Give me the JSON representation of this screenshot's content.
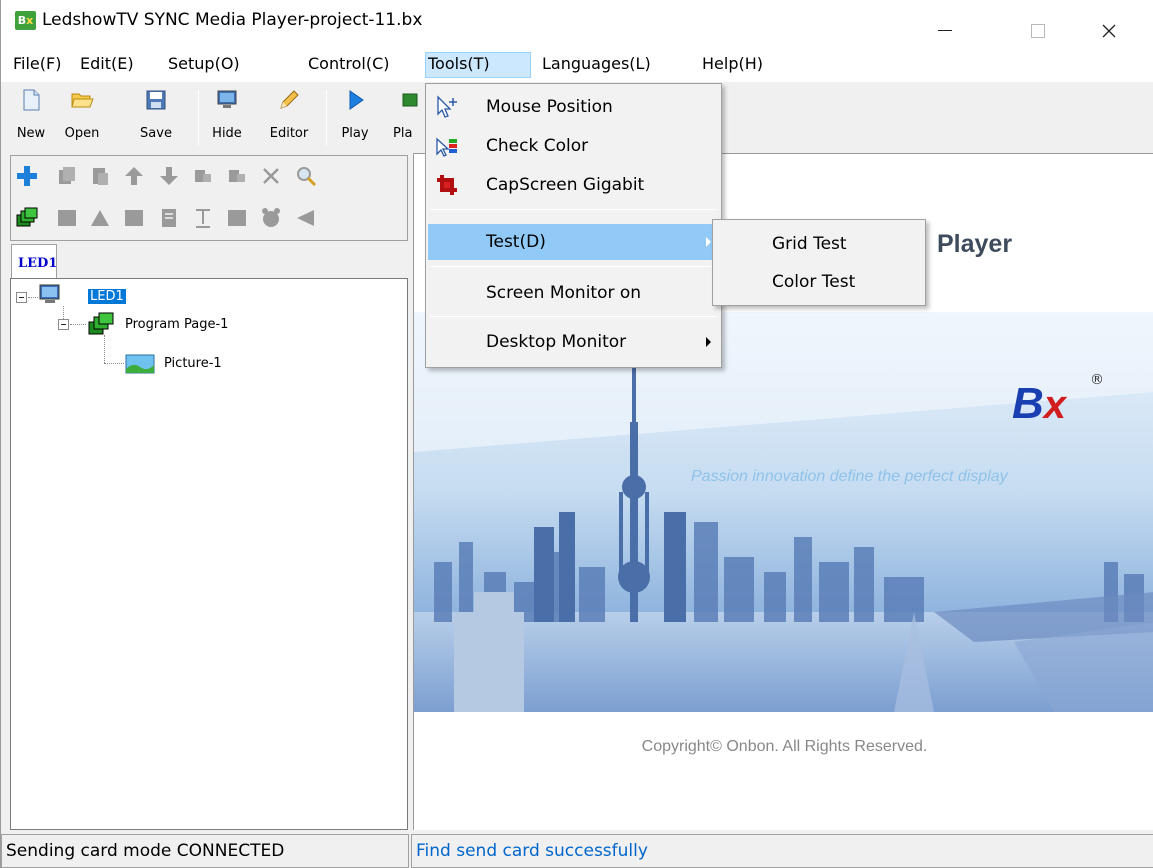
{
  "window": {
    "title": "LedshowTV SYNC Media Player-project-11.bx",
    "icon_text": "Bx"
  },
  "menubar": [
    {
      "label": "File(F)"
    },
    {
      "label": "Edit(E)"
    },
    {
      "label": "Setup(O)"
    },
    {
      "label": "Control(C)"
    },
    {
      "label": "Tools(T)",
      "active": true
    },
    {
      "label": "Languages(L)"
    },
    {
      "label": "Help(H)"
    }
  ],
  "toolbar": {
    "buttons": [
      {
        "label": "New",
        "icon": "new-document-icon"
      },
      {
        "label": "Open",
        "icon": "folder-open-icon"
      },
      {
        "label": "Save",
        "icon": "floppy-disk-icon"
      },
      {
        "label": "Hide",
        "icon": "monitor-icon"
      },
      {
        "label": "Editor",
        "icon": "pencil-icon"
      },
      {
        "label": "Play",
        "icon": "play-icon"
      },
      {
        "label": "Pla",
        "icon": "play-list-icon"
      }
    ]
  },
  "left_panel": {
    "tab_label": "LED1",
    "tree": {
      "root": "LED1",
      "program": "Program Page-1",
      "picture": "Picture-1"
    }
  },
  "tools_menu": {
    "items": [
      {
        "label": "Mouse Position",
        "icon": "mouse-position-icon"
      },
      {
        "label": "Check Color",
        "icon": "check-color-icon"
      },
      {
        "label": "CapScreen Gigabit",
        "icon": "capscreen-icon"
      },
      {
        "label": "Test(D)",
        "has_submenu": true,
        "highlighted": true
      },
      {
        "label": "Screen Monitor on"
      },
      {
        "label": "Desktop Monitor",
        "has_submenu": true
      }
    ],
    "test_submenu": [
      {
        "label": "Grid Test"
      },
      {
        "label": "Color Test"
      }
    ]
  },
  "main": {
    "title_partial": "Player",
    "logo_text": "Bx",
    "logo_mark": "®",
    "tagline": "Passion innovation define the perfect display",
    "copyright": "Copyright© Onbon. All Rights Reserved."
  },
  "statusbar": {
    "left": "Sending card mode CONNECTED",
    "right": "Find send card successfully"
  },
  "colors": {
    "menu_highlight": "#91c9f7",
    "selection": "#0078d7",
    "status_right_text": "#0066cc",
    "logo_blue": "#1a3fb0",
    "logo_red": "#d11d1d"
  }
}
